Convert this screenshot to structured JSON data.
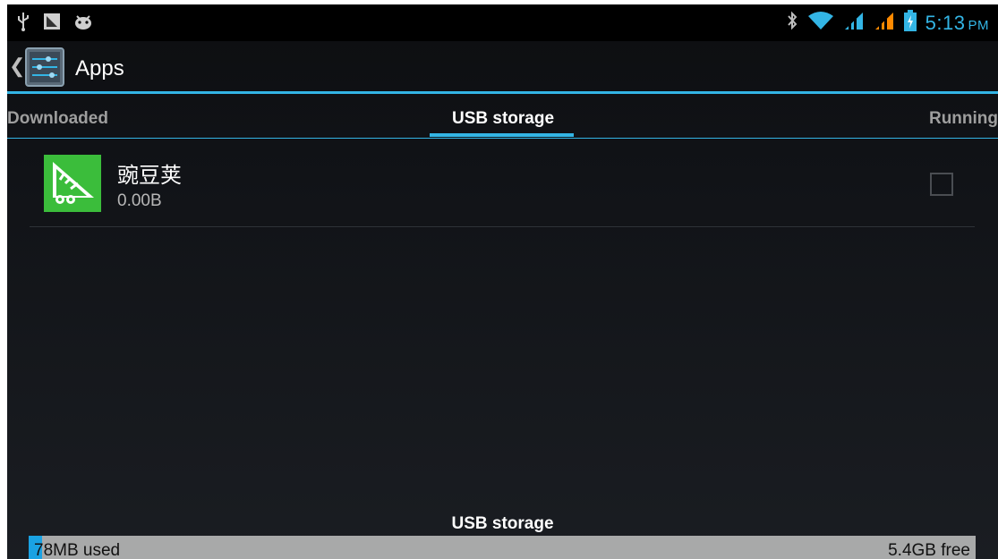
{
  "status_bar": {
    "icons_left": [
      "usb-icon",
      "screenshot-icon",
      "android-debug-icon"
    ],
    "icons_right": [
      "bluetooth-icon",
      "wifi-icon",
      "signal-1-icon",
      "signal-2-icon",
      "battery-charging-icon"
    ],
    "time": "5:13",
    "ampm": "PM"
  },
  "action_bar": {
    "title": "Apps",
    "app_icon": "settings-sliders-icon",
    "back_icon": "chevron-left-icon"
  },
  "tabs": [
    {
      "label": "Downloaded",
      "selected": false
    },
    {
      "label": "USB storage",
      "selected": true
    },
    {
      "label": "Running",
      "selected": false
    }
  ],
  "apps": [
    {
      "name": "豌豆荚",
      "size": "0.00B",
      "icon": "wandoujia-icon",
      "checked": false
    }
  ],
  "storage": {
    "label": "USB storage",
    "used": "78MB used",
    "free": "5.4GB free",
    "used_fraction": 0.014
  },
  "colors": {
    "accent": "#33b5e5",
    "app_icon_bg": "#3bbd3b",
    "storage_bar_bg": "#a8a9a9",
    "storage_used": "#1aa2e3"
  }
}
